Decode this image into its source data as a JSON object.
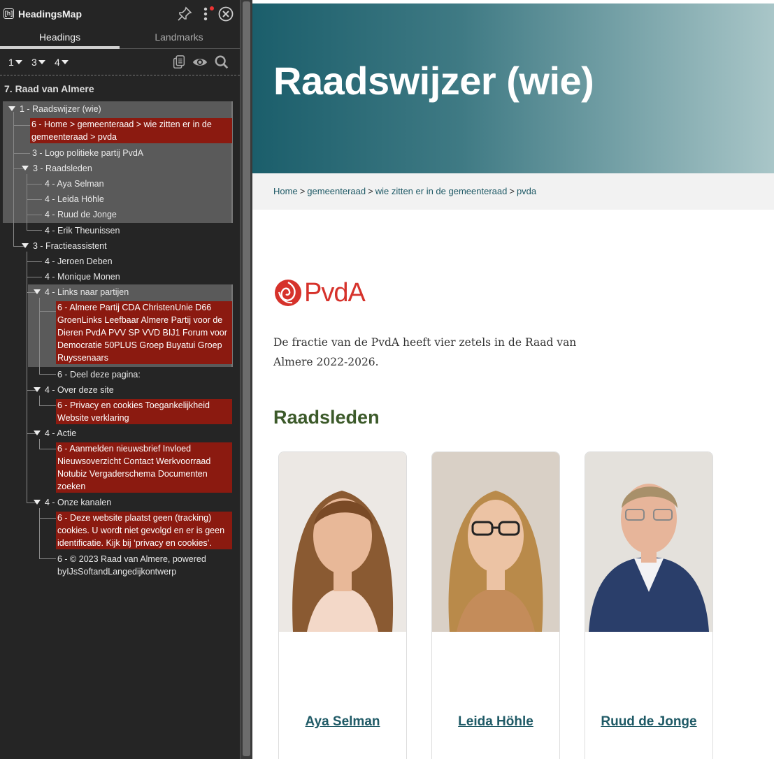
{
  "panel": {
    "title": "HeadingsMap",
    "logo_text": "[h]",
    "tabs": [
      {
        "label": "Headings",
        "active": true
      },
      {
        "label": "Landmarks",
        "active": false
      }
    ],
    "level_buttons": [
      "1",
      "3",
      "4"
    ],
    "tree_title": "7. Raad van Almere",
    "tree": [
      {
        "text": "1 - Raadswijzer (wie)",
        "level": 0,
        "caret": true
      },
      {
        "text": "6 - Home > gemeenteraad > wie zitten er in de gemeenteraad > pvda",
        "level": 1,
        "error": true
      },
      {
        "text": "3 - Logo politieke partij PvdA",
        "level": 1
      },
      {
        "text": "3 - Raadsleden",
        "level": 1,
        "caret": true
      },
      {
        "text": "4 - Aya Selman",
        "level": 2
      },
      {
        "text": "4 - Leida Höhle",
        "level": 2
      },
      {
        "text": "4 - Ruud de Jonge",
        "level": 2
      },
      {
        "text": "4 - Erik Theunissen",
        "level": 2
      },
      {
        "text": "3 - Fractieassistent",
        "level": 1,
        "caret": true
      },
      {
        "text": "4 - Jeroen Deben",
        "level": 2
      },
      {
        "text": "4 - Monique Monen",
        "level": 2
      },
      {
        "text": "4 - Links naar partijen",
        "level": 2,
        "caret": true
      },
      {
        "text": "6 - Almere Partij CDA ChristenUnie D66 GroenLinks Leefbaar Almere Partij voor de Dieren PvdA PVV SP VVD BIJ1 Forum voor Democratie 50PLUS Groep Buyatui Groep Ruyssenaars",
        "level": 3,
        "error": true
      },
      {
        "text": "6 - Deel deze pagina:",
        "level": 3
      },
      {
        "text": "4 - Over deze site",
        "level": 2,
        "caret": true
      },
      {
        "text": "6 - Privacy en cookies Toegankelijkheid Website verklaring",
        "level": 3,
        "error": true
      },
      {
        "text": "4 - Actie",
        "level": 2,
        "caret": true
      },
      {
        "text": "6 - Aanmelden nieuwsbrief Invloed Nieuwsoverzicht Contact Werkvoorraad Notubiz Vergaderschema Documenten zoeken",
        "level": 3,
        "error": true
      },
      {
        "text": "4 - Onze kanalen",
        "level": 2,
        "caret": true
      },
      {
        "text": "6 - Deze website plaatst geen (tracking) cookies. U wordt niet gevolgd en er is geen identificatie. Kijk bij ‘privacy en cookies’.",
        "level": 3,
        "error": true
      },
      {
        "text": "6 - © 2023 Raad van Almere, powered byIJsSoftandLangedijkontwerp",
        "level": 3
      }
    ]
  },
  "page": {
    "hero_title": "Raadswijzer (wie)",
    "breadcrumbs": [
      "Home",
      "gemeenteraad",
      "wie zitten er in de gemeenteraad",
      "pvda"
    ],
    "breadcrumb_separator": ">",
    "logo_text": "PvdA",
    "intro": "De fractie van de PvdA heeft vier zetels in de Raad van Almere 2022-2026.",
    "section_title": "Raadsleden",
    "members": [
      {
        "name": "Aya Selman"
      },
      {
        "name": "Leida Höhle"
      },
      {
        "name": "Ruud de Jonge"
      }
    ]
  },
  "colors": {
    "panel_bg": "#252525",
    "error_bg": "#8b1a10",
    "hero_start": "#1b5e6b",
    "hero_end": "#a9c6c8",
    "section_title": "#3c5a2a",
    "link": "#1f5a66",
    "pvda_red": "#d6322b"
  }
}
